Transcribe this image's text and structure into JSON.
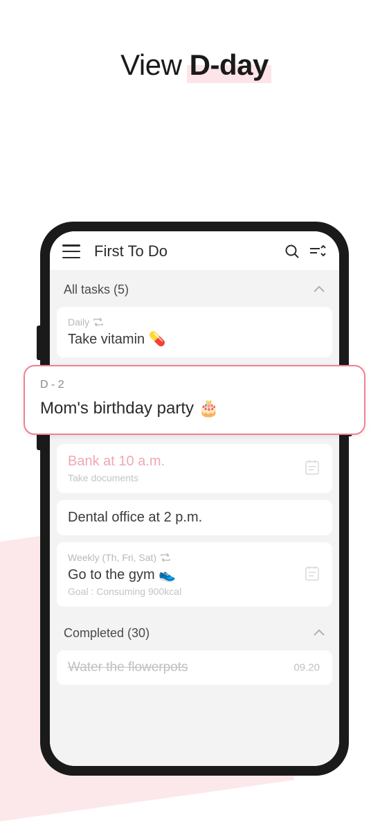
{
  "promo": {
    "prefix": "View ",
    "bold": "D-day"
  },
  "header": {
    "title": "First To Do"
  },
  "sections": {
    "all_tasks": "All tasks (5)",
    "completed": "Completed (30)"
  },
  "tasks": [
    {
      "meta": "Daily",
      "title": "Take vitamin 💊",
      "has_repeat": true
    },
    {
      "meta": "D - 2",
      "title": "Mom's birthday party 🎂",
      "highlighted": true
    },
    {
      "title": "Bank at 10 a.m.",
      "sub": "Take documents",
      "pink": true,
      "has_note": true
    },
    {
      "title": "Dental office at 2 p.m."
    },
    {
      "meta": "Weekly (Th, Fri, Sat)",
      "title": "Go to the gym 👟",
      "sub": "Goal : Consuming 900kcal",
      "has_repeat": true,
      "has_note": true
    }
  ],
  "completed_tasks": [
    {
      "title": "Water the flowerpots",
      "date": "09.20"
    }
  ]
}
